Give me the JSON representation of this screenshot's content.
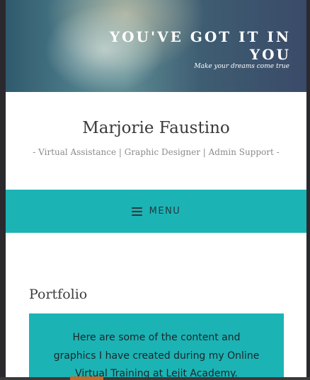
{
  "header": {
    "banner_title": "YOU'VE GOT IT IN YOU",
    "banner_tagline": "Make your dreams come true"
  },
  "site": {
    "title": "Marjorie Faustino",
    "description": "- Virtual Assistance | Graphic Designer | Admin Support -"
  },
  "nav": {
    "menu_label": "MENU",
    "menu_icon": "hamburger-icon"
  },
  "main": {
    "section_title": "Portfolio",
    "intro_lines": [
      "Here are some of the content and",
      "graphics I have created during my Online",
      "Virtual Training at Lejit Academy."
    ]
  },
  "colors": {
    "accent": "#1cb3b5",
    "page_background": "#ffffff",
    "bottom_accent": "#c26a2c"
  }
}
